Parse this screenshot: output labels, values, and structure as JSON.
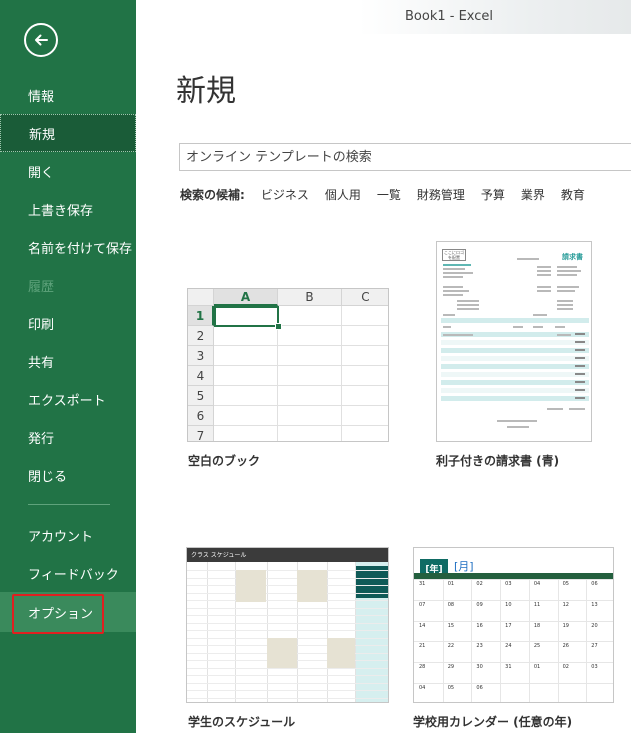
{
  "window": {
    "title": "Book1  -  Excel"
  },
  "sidebar": {
    "back_icon": "back-arrow-icon",
    "items": [
      {
        "label": "情報",
        "state": "normal"
      },
      {
        "label": "新規",
        "state": "selected"
      },
      {
        "label": "開く",
        "state": "normal"
      },
      {
        "label": "上書き保存",
        "state": "normal"
      },
      {
        "label": "名前を付けて保存",
        "state": "normal"
      },
      {
        "label": "履歴",
        "state": "disabled"
      },
      {
        "label": "印刷",
        "state": "normal"
      },
      {
        "label": "共有",
        "state": "normal"
      },
      {
        "label": "エクスポート",
        "state": "normal"
      },
      {
        "label": "発行",
        "state": "normal"
      },
      {
        "label": "閉じる",
        "state": "normal"
      },
      {
        "label": "アカウント",
        "state": "normal"
      },
      {
        "label": "フィードバック",
        "state": "normal"
      },
      {
        "label": "オプション",
        "state": "hover-highlighted"
      }
    ],
    "colors": {
      "background": "#217346",
      "selected": "#1a5c38",
      "highlight_border": "#e02020"
    }
  },
  "main": {
    "page_title": "新規",
    "search": {
      "placeholder": "オンライン テンプレートの検索",
      "value": ""
    },
    "suggestions": {
      "label": "検索の候補:",
      "items": [
        "ビジネス",
        "個人用",
        "一覧",
        "財務管理",
        "予算",
        "業界",
        "教育"
      ]
    },
    "templates": [
      {
        "label": "空白のブック",
        "thumbnail": {
          "columns": [
            "A",
            "B",
            "C"
          ],
          "rows": [
            "1",
            "2",
            "3",
            "4",
            "5",
            "6",
            "7"
          ]
        }
      },
      {
        "label": "利子付きの請求書 (青)",
        "thumbnail": {
          "heading": "請求書",
          "logo": "ここにロゴを配置"
        }
      },
      {
        "label": "学生のスケジュール",
        "thumbnail": {
          "heading": "クラス スケジュール"
        }
      },
      {
        "label": "学校用カレンダー (任意の年)",
        "thumbnail": {
          "year": "[年]",
          "month": "[月]",
          "dates": [
            [
              "31",
              "01",
              "02",
              "03",
              "04",
              "05",
              "06"
            ],
            [
              "07",
              "08",
              "09",
              "10",
              "11",
              "12",
              "13"
            ],
            [
              "14",
              "15",
              "16",
              "17",
              "18",
              "19",
              "20"
            ],
            [
              "21",
              "22",
              "23",
              "24",
              "25",
              "26",
              "27"
            ],
            [
              "28",
              "29",
              "30",
              "31",
              "01",
              "02",
              "03"
            ],
            [
              "04",
              "05",
              "06",
              "",
              "",
              "",
              ""
            ]
          ]
        }
      }
    ]
  }
}
